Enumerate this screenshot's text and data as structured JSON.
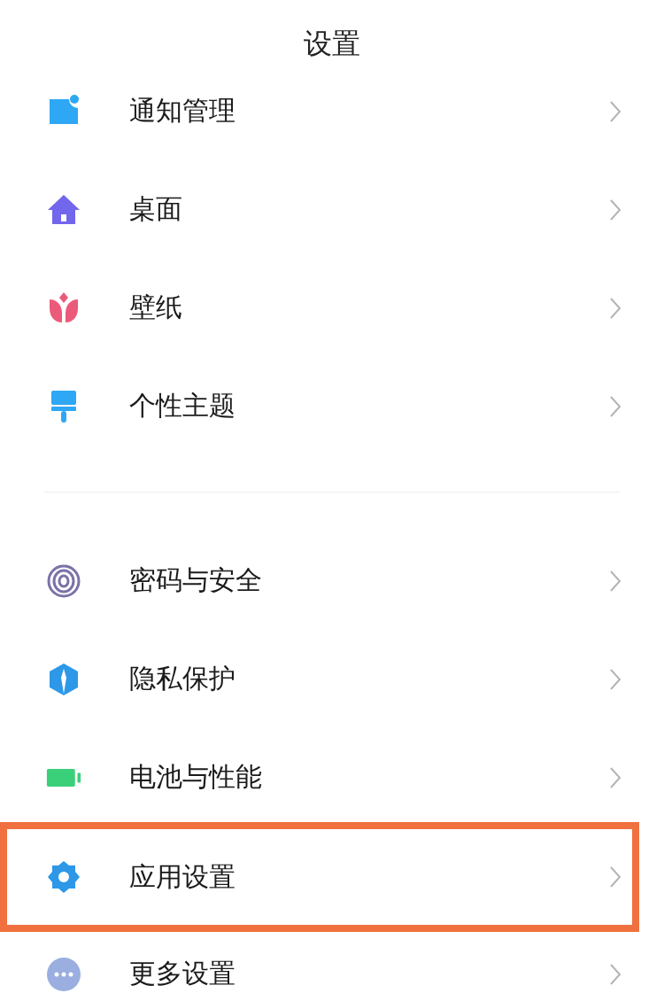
{
  "title": "设置",
  "groups": [
    {
      "items": [
        {
          "label": "通知管理",
          "kind": "notification",
          "highlighted": false
        },
        {
          "label": "桌面",
          "kind": "home",
          "highlighted": false
        },
        {
          "label": "壁纸",
          "kind": "tulip",
          "highlighted": false
        },
        {
          "label": "个性主题",
          "kind": "brush",
          "highlighted": false
        }
      ]
    },
    {
      "items": [
        {
          "label": "密码与安全",
          "kind": "fingerprint",
          "highlighted": false
        },
        {
          "label": "隐私保护",
          "kind": "shield",
          "highlighted": false
        },
        {
          "label": "电池与性能",
          "kind": "battery",
          "highlighted": false
        },
        {
          "label": "应用设置",
          "kind": "gear",
          "highlighted": true
        },
        {
          "label": "更多设置",
          "kind": "more",
          "highlighted": false
        }
      ]
    }
  ]
}
